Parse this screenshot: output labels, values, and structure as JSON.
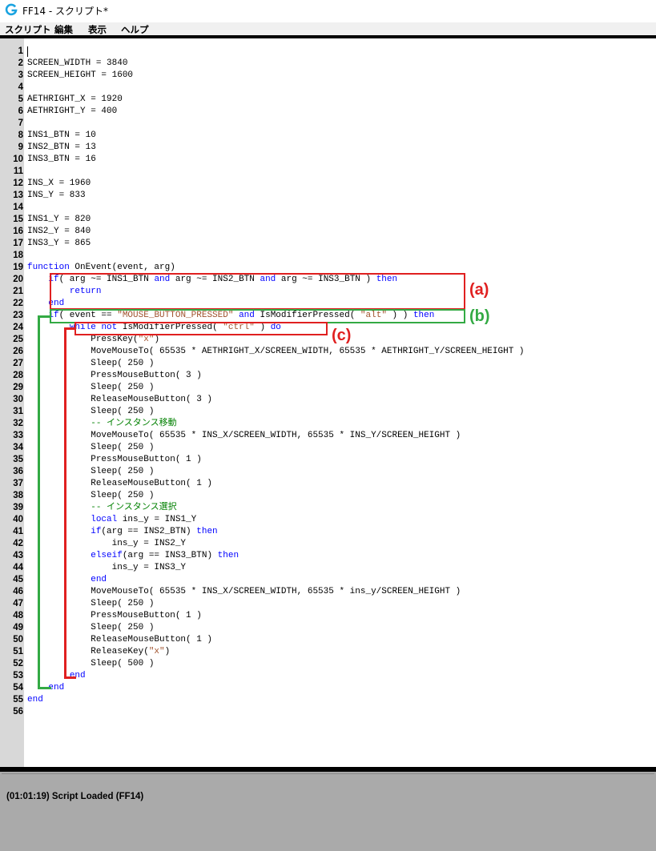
{
  "window": {
    "title": "FF14 - スクリプト*"
  },
  "menu": {
    "items": [
      "スクリプト",
      "編集",
      "表示",
      "ヘルプ"
    ]
  },
  "editor": {
    "lines": [
      "",
      "SCREEN_WIDTH = 3840",
      "SCREEN_HEIGHT = 1600",
      "",
      "AETHRIGHT_X = 1920",
      "AETHRIGHT_Y = 400",
      "",
      "INS1_BTN = 10",
      "INS2_BTN = 13",
      "INS3_BTN = 16",
      "",
      "INS_X = 1960",
      "INS_Y = 833",
      "",
      "INS1_Y = 820",
      "INS2_Y = 840",
      "INS3_Y = 865",
      "",
      "function OnEvent(event, arg)",
      "    if( arg ~= INS1_BTN and arg ~= INS2_BTN and arg ~= INS3_BTN ) then",
      "        return",
      "    end",
      "    if( event == \"MOUSE_BUTTON_PRESSED\" and IsModifierPressed( \"alt\" ) ) then",
      "        while not IsModifierPressed( \"ctrl\" ) do",
      "            PressKey(\"x\")",
      "            MoveMouseTo( 65535 * AETHRIGHT_X/SCREEN_WIDTH, 65535 * AETHRIGHT_Y/SCREEN_HEIGHT )",
      "            Sleep( 250 )",
      "            PressMouseButton( 3 )",
      "            Sleep( 250 )",
      "            ReleaseMouseButton( 3 )",
      "            Sleep( 250 )",
      "            -- インスタンス移動",
      "            MoveMouseTo( 65535 * INS_X/SCREEN_WIDTH, 65535 * INS_Y/SCREEN_HEIGHT )",
      "            Sleep( 250 )",
      "            PressMouseButton( 1 )",
      "            Sleep( 250 )",
      "            ReleaseMouseButton( 1 )",
      "            Sleep( 250 )",
      "            -- インスタンス選択",
      "            local ins_y = INS1_Y",
      "            if(arg == INS2_BTN) then",
      "                ins_y = INS2_Y",
      "            elseif(arg == INS3_BTN) then",
      "                ins_y = INS3_Y",
      "            end",
      "            MoveMouseTo( 65535 * INS_X/SCREEN_WIDTH, 65535 * ins_y/SCREEN_HEIGHT )",
      "            Sleep( 250 )",
      "            PressMouseButton( 1 )",
      "            Sleep( 250 )",
      "            ReleaseMouseButton( 1 )",
      "            ReleaseKey(\"x\")",
      "            Sleep( 500 )",
      "        end",
      "    end",
      "end",
      ""
    ]
  },
  "annotations": [
    {
      "label": "(a)",
      "color": "#e02020"
    },
    {
      "label": "(b)",
      "color": "#33aa44"
    },
    {
      "label": "(c)",
      "color": "#e02020"
    }
  ],
  "status": {
    "message": "(01:01:19) Script Loaded (FF14)"
  },
  "colors": {
    "keyword": "#0000ff",
    "string": "#a0522d",
    "comment": "#008000"
  }
}
